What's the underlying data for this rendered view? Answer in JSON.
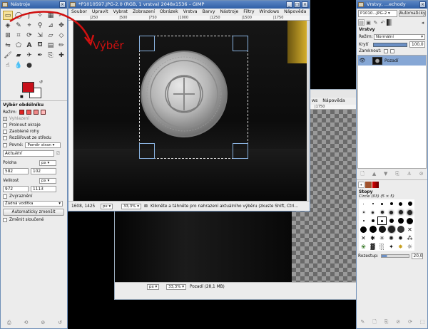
{
  "toolbox": {
    "title": "Nástroje",
    "tool_options_title": "Výběr obdélníku",
    "mode_label": "Režim:",
    "replace_label": "Vyhlazení",
    "feather_label": "Prolnout okraje",
    "rounded_label": "Zaoblené rohy",
    "expand_label": "Rozšiřovat ze středu",
    "fixed_label": "Pevné:",
    "fixed_value": "Poměr stran",
    "current_value": "Aktuální",
    "position_label": "Poloha",
    "position_unit": "px",
    "pos_x": "582",
    "pos_y": "102",
    "size_label": "Velikost",
    "size_unit": "px",
    "size_w": "972",
    "size_h": "1113",
    "highlight_label": "Zvýraznění",
    "guides_value": "Žádná vodítka",
    "shrink_button": "Automaticky zmenšit",
    "merged_label": "Změnit sloučené"
  },
  "annotation": {
    "text": "Výběr",
    "color": "#d01010"
  },
  "image_window": {
    "title": "*P1010597.JPG-2.0 (RGB, 1 vrstva) 2048x1536 – GIMP",
    "menus": [
      "Soubor",
      "Upravit",
      "Vybrat",
      "Zobrazení",
      "Obrázek",
      "Vrstva",
      "Barvy",
      "Nástroje",
      "Filtry",
      "Windows",
      "Nápověda"
    ],
    "ruler_marks": [
      "|250",
      "|500",
      "|750",
      "|1000",
      "|1250",
      "|1500",
      "|1750"
    ],
    "coords": "1608, 1425",
    "unit": "px",
    "zoom": "33,3%",
    "status": "Klikněte a táhněte pro nahrazení aktuálního výběru (zkuste Shift, Ctrl..."
  },
  "image_window_2": {
    "menus": [
      "ws",
      "Nápověda"
    ],
    "ruler_mark": "|1750",
    "unit": "px",
    "zoom": "33,3%",
    "status": "Pozadí (28,1 MB)"
  },
  "layers_dock": {
    "title": "Vrstvy, ...echody",
    "image_combo": "P1010...JPG-2",
    "auto_button": "Automaticky",
    "layers_tab": "Vrstvy",
    "mode_label": "Režim:",
    "mode_value": "Normální",
    "opacity_label": "Krytí",
    "opacity_value": "100,0",
    "lock_label": "Zamknout:",
    "layer_name": "Pozadí",
    "brushes_title": "Stopy",
    "brush_name": "Circle (03) (5 × 5)",
    "spacing_label": "Rozestup:",
    "spacing_value": "20,0"
  },
  "colors": {
    "fg": "#c8101a",
    "bg": "#ffffff",
    "title_grad_top": "#5b86c4",
    "title_grad_bottom": "#2f5fa6"
  }
}
